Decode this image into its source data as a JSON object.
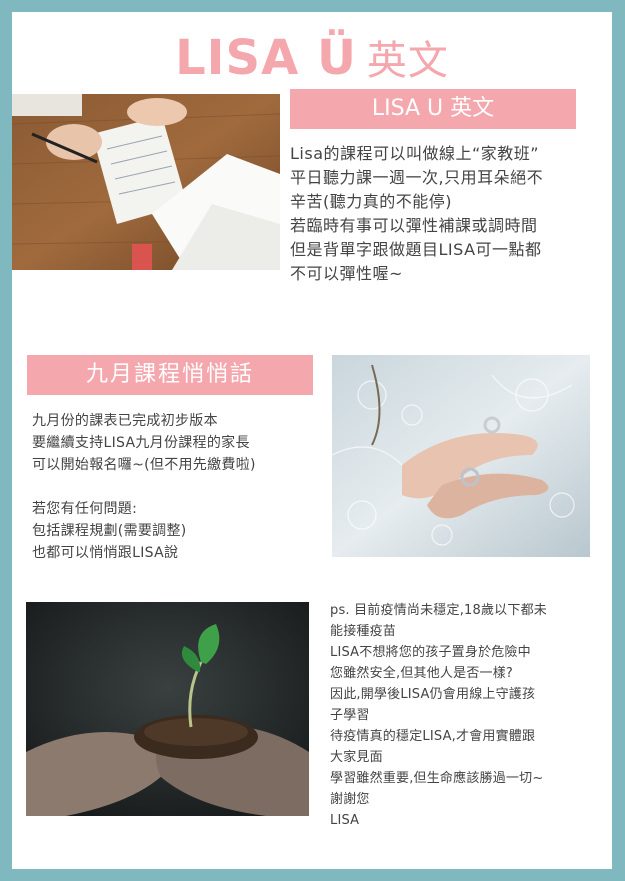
{
  "header": {
    "title_latin": "LISA Ü",
    "title_cn": "英文"
  },
  "section1": {
    "bar_label": "LISA U 英文",
    "lines": [
      "Lisa的課程可以叫做線上“家教班”",
      "平日聽力課一週一次,只用耳朵絕不",
      "辛苦(聽力真的不能停)",
      "若臨時有事可以彈性補課或調時間",
      "但是背單字跟做題目LISA可一點都",
      "不可以彈性喔~"
    ]
  },
  "section2": {
    "bar_label": "九月課程悄悄話",
    "lines": [
      "九月份的課表已完成初步版本",
      "要繼續支持LISA九月份課程的家長",
      "可以開始報名囉~(但不用先繳費啦)",
      "",
      "若您有任何問題:",
      "包括課程規劃(需要調整)",
      "也都可以悄悄跟LISA說"
    ]
  },
  "section3": {
    "lines": [
      "ps. 目前疫情尚未穩定,18歲以下都未",
      "能接種疫苗",
      "LISA不想將您的孩子置身於危險中",
      "您雖然安全,但其他人是否一樣?",
      "因此,開學後LISA仍會用線上守護孩",
      "子學習",
      "待疫情真的穩定LISA,才會用實體跟",
      "大家見面",
      "學習雖然重要,但生命應該勝過一切~",
      "謝謝您",
      "LISA"
    ]
  },
  "colors": {
    "accent": "#f4a7ad",
    "frame": "#7fb8bf",
    "text": "#444444"
  }
}
